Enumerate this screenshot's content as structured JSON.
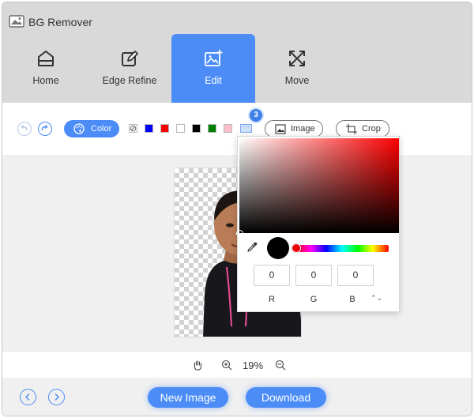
{
  "app": {
    "title": "BG Remover"
  },
  "nav": {
    "items": [
      {
        "label": "Home",
        "icon": "home-icon"
      },
      {
        "label": "Edge Refine",
        "icon": "pencil-square-icon"
      },
      {
        "label": "Edit",
        "icon": "image-edit-icon",
        "active": true
      },
      {
        "label": "Move",
        "icon": "move-arrows-icon"
      }
    ]
  },
  "toolbar": {
    "color_label": "Color",
    "image_label": "Image",
    "crop_label": "Crop",
    "step_badge": "3",
    "swatches": [
      "#0000ff",
      "#ff0000",
      "#ffffff",
      "#000000",
      "#008000",
      "#ffc0cb"
    ],
    "more_label": "···"
  },
  "picker": {
    "r": "0",
    "g": "0",
    "b": "0",
    "r_label": "R",
    "g_label": "G",
    "b_label": "B",
    "mode_toggle": "⌃⌄"
  },
  "zoom": {
    "value": "19%"
  },
  "footer": {
    "new_image_label": "New Image",
    "download_label": "Download"
  },
  "colors": {
    "accent": "#4b8cf7",
    "header_bg": "#d9d9d9",
    "canvas_bg": "#f0f0f0"
  }
}
